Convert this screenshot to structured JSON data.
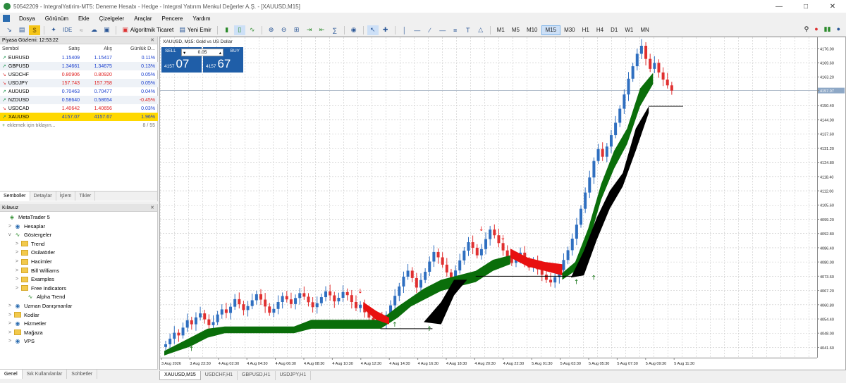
{
  "window": {
    "title": "50542209 - IntegralYatirim-MT5: Deneme Hesabı - Hedge - Integral Yatırım Menkul Değerler A.Ş. - [XAUUSD,M15]"
  },
  "menu": [
    "Dosya",
    "Görünüm",
    "Ekle",
    "Çizelgeler",
    "Araçlar",
    "Pencere",
    "Yardım"
  ],
  "toolbar": {
    "ide_label": "IDE",
    "algo_label": "Algoritmik Ticaret",
    "new_order_label": "Yeni Emir",
    "timeframes": [
      "M1",
      "M5",
      "M10",
      "M15",
      "M30",
      "H1",
      "H4",
      "D1",
      "W1",
      "MN"
    ],
    "active_timeframe": "M15"
  },
  "market_watch": {
    "title": "Piyasa Gözlemi: 12:53:22",
    "columns": [
      "Sembol",
      "Satış",
      "Alış",
      "Günlük D..."
    ],
    "rows": [
      {
        "symbol": "EURUSD",
        "bid": "1.15409",
        "ask": "1.15417",
        "change": "0.11%",
        "dir": "up",
        "neg": false
      },
      {
        "symbol": "GBPUSD",
        "bid": "1.34661",
        "ask": "1.34675",
        "change": "0.13%",
        "dir": "up",
        "neg": false
      },
      {
        "symbol": "USDCHF",
        "bid": "0.80906",
        "ask": "0.80920",
        "change": "0.05%",
        "dir": "down",
        "neg": false
      },
      {
        "symbol": "USDJPY",
        "bid": "157.743",
        "ask": "157.758",
        "change": "0.05%",
        "dir": "down",
        "neg": false
      },
      {
        "symbol": "AUDUSD",
        "bid": "0.70463",
        "ask": "0.70477",
        "change": "0.04%",
        "dir": "up",
        "neg": false
      },
      {
        "symbol": "NZDUSD",
        "bid": "0.58640",
        "ask": "0.58654",
        "change": "-0.45%",
        "dir": "up",
        "neg": true
      },
      {
        "symbol": "USDCAD",
        "bid": "1.40642",
        "ask": "1.40656",
        "change": "0.03%",
        "dir": "down",
        "neg": false
      },
      {
        "symbol": "XAUUSD",
        "bid": "4157.07",
        "ask": "4157.67",
        "change": "1.96%",
        "dir": "up",
        "neg": false
      }
    ],
    "add_text": "eklemek için tıklayın...",
    "count": "8 / 55",
    "tabs": [
      "Semboller",
      "Detaylar",
      "İşlem",
      "Tikler"
    ]
  },
  "navigator": {
    "title": "Kılavuz",
    "items": [
      {
        "label": "MetaTrader 5",
        "icon": "mt5-icon"
      },
      {
        "label": "Hesaplar",
        "icon": "accounts-icon"
      },
      {
        "label": "Göstergeler",
        "icon": "indicators-icon"
      },
      {
        "label": "Trend",
        "icon": "folder-icon"
      },
      {
        "label": "Osilatörler",
        "icon": "folder-icon"
      },
      {
        "label": "Hacimler",
        "icon": "folder-icon"
      },
      {
        "label": "Bill Williams",
        "icon": "folder-icon"
      },
      {
        "label": "Examples",
        "icon": "folder-icon"
      },
      {
        "label": "Free Indicators",
        "icon": "folder-icon"
      },
      {
        "label": "Alpha Trend",
        "icon": "indicator-icon"
      },
      {
        "label": "Uzman Danışmanlar",
        "icon": "experts-icon"
      },
      {
        "label": "Kodlar",
        "icon": "folder-icon"
      },
      {
        "label": "Hizmetler",
        "icon": "services-icon"
      },
      {
        "label": "Mağaza",
        "icon": "folder-icon"
      },
      {
        "label": "VPS",
        "icon": "vps-icon"
      }
    ],
    "tabs": [
      "Genel",
      "Sık Kullanılanlar",
      "Sohbetler"
    ]
  },
  "chart": {
    "label": "XAUUSD, M15:  Gold vs US Dollar",
    "trade": {
      "sell": "SELL",
      "buy": "BUY",
      "volume": "0.05",
      "sell_prefix": "4157",
      "sell_big": "07",
      "buy_prefix": "4157",
      "buy_big": "67"
    },
    "price_labels": [
      "4176.00",
      "4169.60",
      "4163.20",
      "4157.07",
      "4150.40",
      "4144.00",
      "4137.60",
      "4131.20",
      "4124.80",
      "4118.40",
      "4112.00",
      "4105.60",
      "4099.20",
      "4092.80",
      "4086.40",
      "4080.00",
      "4073.60",
      "4067.20",
      "4060.80",
      "4054.40",
      "4048.00",
      "4041.60"
    ],
    "time_labels": [
      "3 Aug 2026",
      "3 Aug 23:30",
      "4 Aug 02:30",
      "4 Aug 04:30",
      "4 Aug 06:30",
      "4 Aug 08:30",
      "4 Aug 10:30",
      "4 Aug 12:30",
      "4 Aug 14:30",
      "4 Aug 16:30",
      "4 Aug 18:30",
      "4 Aug 20:30",
      "4 Aug 22:30",
      "5 Aug 01:30",
      "5 Aug 03:30",
      "5 Aug 05:30",
      "5 Aug 07:30",
      "5 Aug 09:30",
      "5 Aug 11:30"
    ],
    "tabs": [
      "XAUUSD,M15",
      "USDCHF,H1",
      "GBPUSD,H1",
      "USDJPY,H1"
    ],
    "colors": {
      "up": "#2f6fc0",
      "down": "#e03030",
      "green_band": "#0a6e0a",
      "black_band": "#000000",
      "red_band": "#e81010"
    }
  },
  "chart_data": {
    "type": "candlestick",
    "symbol": "XAUUSD",
    "timeframe": "M15",
    "ylim": [
      4037,
      4181
    ],
    "bid_line": 4157.07,
    "grid": true,
    "closes": [
      4043.0,
      4045.5,
      4048.2,
      4047.0,
      4050.5,
      4053.8,
      4052.0,
      4055.1,
      4056.9,
      4054.2,
      4051.6,
      4053.0,
      4056.4,
      4058.7,
      4057.1,
      4059.9,
      4063.3,
      4061.0,
      4058.4,
      4060.2,
      4062.8,
      4065.5,
      4063.1,
      4060.0,
      4057.2,
      4058.9,
      4062.0,
      4064.7,
      4063.2,
      4061.1,
      4063.8,
      4066.0,
      4064.4,
      4061.9,
      4059.7,
      4061.5,
      4064.2,
      4066.8,
      4065.0,
      4062.3,
      4063.9,
      4066.5,
      4065.1,
      4062.0,
      4059.3,
      4060.8,
      4057.4,
      4055.0,
      4052.8,
      4054.6,
      4053.0,
      4056.2,
      4060.5,
      4064.8,
      4069.0,
      4073.4,
      4076.1,
      4072.8,
      4068.5,
      4071.9,
      4075.6,
      4080.2,
      4084.5,
      4082.1,
      4078.8,
      4075.3,
      4073.0,
      4076.2,
      4080.7,
      4085.1,
      4088.9,
      4086.4,
      4083.0,
      4085.8,
      4090.3,
      4094.6,
      4092.0,
      4088.5,
      4085.2,
      4082.0,
      4079.6,
      4081.8,
      4084.2,
      4080.6,
      4077.5,
      4079.9,
      4076.7,
      4074.3,
      4072.0,
      4070.8,
      4073.2,
      4076.4,
      4080.9,
      4085.3,
      4090.5,
      4096.8,
      4103.9,
      4111.2,
      4118.0,
      4125.4,
      4130.8,
      4127.3,
      4131.9,
      4137.0,
      4142.6,
      4148.9,
      4155.3,
      4162.4,
      4168.0,
      4173.6,
      4177.2,
      4171.3,
      4166.8,
      4169.5,
      4165.2,
      4162.0,
      4159.4,
      4157.07
    ]
  }
}
